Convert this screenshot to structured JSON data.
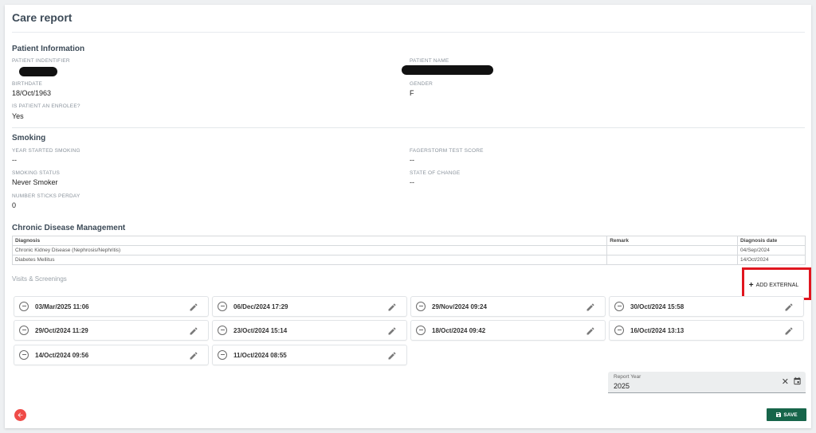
{
  "page": {
    "title": "Care report"
  },
  "patient": {
    "section_title": "Patient Information",
    "identifier_label": "PATIENT INDENTIFIER",
    "name_label": "PATIENT NAME",
    "birthdate_label": "BIRTHDATE",
    "birthdate": "18/Oct/1963",
    "gender_label": "GENDER",
    "gender": "F",
    "enrolee_label": "IS PATIENT AN ENROLEE?",
    "enrolee": "Yes"
  },
  "smoking": {
    "section_title": "Smoking",
    "year_started_label": "YEAR STARTED SMOKING",
    "year_started": "--",
    "fagerstorm_label": "FAGERSTORM TEST SCORE",
    "fagerstorm": "--",
    "status_label": "SMOKING STATUS",
    "status": "Never Smoker",
    "state_change_label": "STATE OF CHANGE",
    "state_change": "--",
    "sticks_label": "NUMBER STICKS PERDAY",
    "sticks": "0"
  },
  "chronic": {
    "section_title": "Chronic Disease Management",
    "columns": [
      "Diagnosis",
      "Remark",
      "Diagnosis date"
    ],
    "rows": [
      [
        "Chronic Kidney Disease (Nephrosis/Nephritis)",
        "",
        "04/Sep/2024"
      ],
      [
        "Diabetes Mellitus",
        "",
        "14/Oct/2024"
      ]
    ]
  },
  "visits": {
    "label": "Visits & Screenings",
    "add_external_label": "ADD EXTERNAL",
    "items": [
      "03/Mar/2025 11:06",
      "06/Dec/2024 17:29",
      "29/Nov/2024 09:24",
      "30/Oct/2024 15:58",
      "29/Oct/2024 11:29",
      "23/Oct/2024 15:14",
      "18/Oct/2024 09:42",
      "16/Oct/2024 13:13",
      "14/Oct/2024 09:56",
      "11/Oct/2024 08:55"
    ]
  },
  "report_year": {
    "label": "Report Year",
    "value": "2025"
  },
  "actions": {
    "save_label": "SAVE"
  },
  "icons": {
    "back": "arrow-left-icon",
    "remove": "minus-circle-icon",
    "edit": "pencil-icon",
    "add": "plus-icon",
    "clear": "close-icon",
    "calendar": "calendar-icon",
    "save": "floppy-disk-icon"
  },
  "colors": {
    "save_bg": "#17654a",
    "back_bg": "#ef4b48",
    "highlight": "#e0161f"
  }
}
